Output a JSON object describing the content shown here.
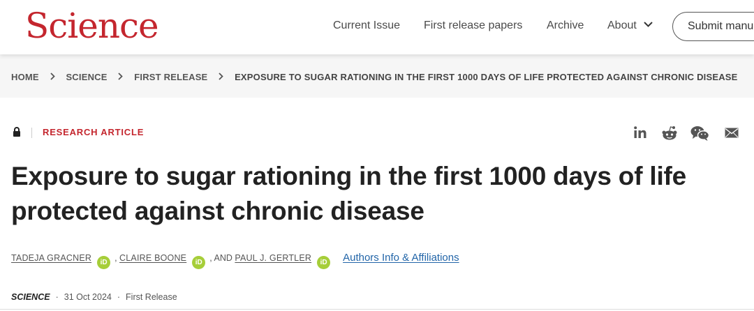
{
  "header": {
    "logo": "Science",
    "nav": [
      {
        "label": "Current Issue"
      },
      {
        "label": "First release papers"
      },
      {
        "label": "Archive"
      },
      {
        "label": "About"
      }
    ],
    "submit_label": "Submit manu"
  },
  "breadcrumb": {
    "items": [
      "HOME",
      "SCIENCE",
      "FIRST RELEASE",
      "EXPOSURE TO SUGAR RATIONING IN THE FIRST 1000 DAYS OF LIFE PROTECTED AGAINST CHRONIC DISEASE"
    ]
  },
  "article": {
    "type": "RESEARCH ARTICLE",
    "title": "Exposure to sugar rationing in the first 1000 days of life protected against chronic disease",
    "authors": [
      "TADEJA GRACNER",
      "CLAIRE BOONE",
      "PAUL J. GERTLER"
    ],
    "author_sep_1": ", ",
    "author_sep_2": ", AND ",
    "orcid_text": "iD",
    "affiliations_link": "Authors Info & Affiliations",
    "journal": "SCIENCE",
    "date": "31 Oct 2024",
    "release": "First Release"
  },
  "share_icons": [
    "linkedin-icon",
    "reddit-icon",
    "wechat-icon",
    "email-icon"
  ],
  "colors": {
    "brand_red": "#c4262e",
    "link_blue": "#2265a8",
    "orcid_green": "#a6ce39"
  }
}
